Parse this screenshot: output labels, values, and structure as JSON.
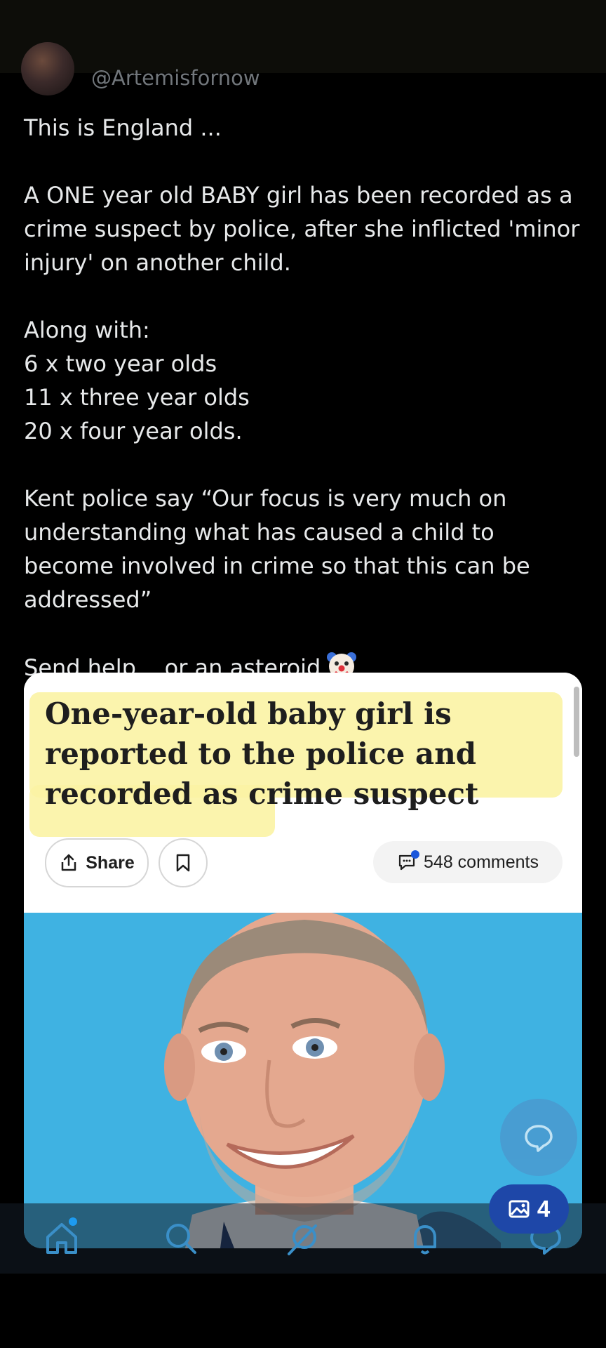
{
  "post": {
    "handle": "@Artemisfornow",
    "lines": [
      "This is England ...",
      "A ONE year old BABY girl has been recorded as a crime suspect by police, after she inflicted 'minor injury' on another child.",
      "Along with:",
      "6 x two year olds",
      "11 x three year olds",
      "20 x four year olds.",
      "Kent police say “Our focus is very much on understanding what has caused a child to become involved in crime so that this can be addressed”",
      "Send help... or an asteroid"
    ],
    "emoji": "clown-face"
  },
  "card": {
    "headline": "One-year-old baby girl is reported to the police and recorded as crime suspect",
    "share_label": "Share",
    "comments_label": "548 comments"
  },
  "media_badge": {
    "count": "4"
  },
  "nav": {
    "items": [
      "home-icon",
      "search-icon",
      "grok-icon",
      "notifications-icon",
      "messages-icon"
    ]
  },
  "colors": {
    "background": "#000000",
    "text": "#e7e9ea",
    "highlight": "#fbf3a4",
    "accent": "#1d9bf0"
  }
}
